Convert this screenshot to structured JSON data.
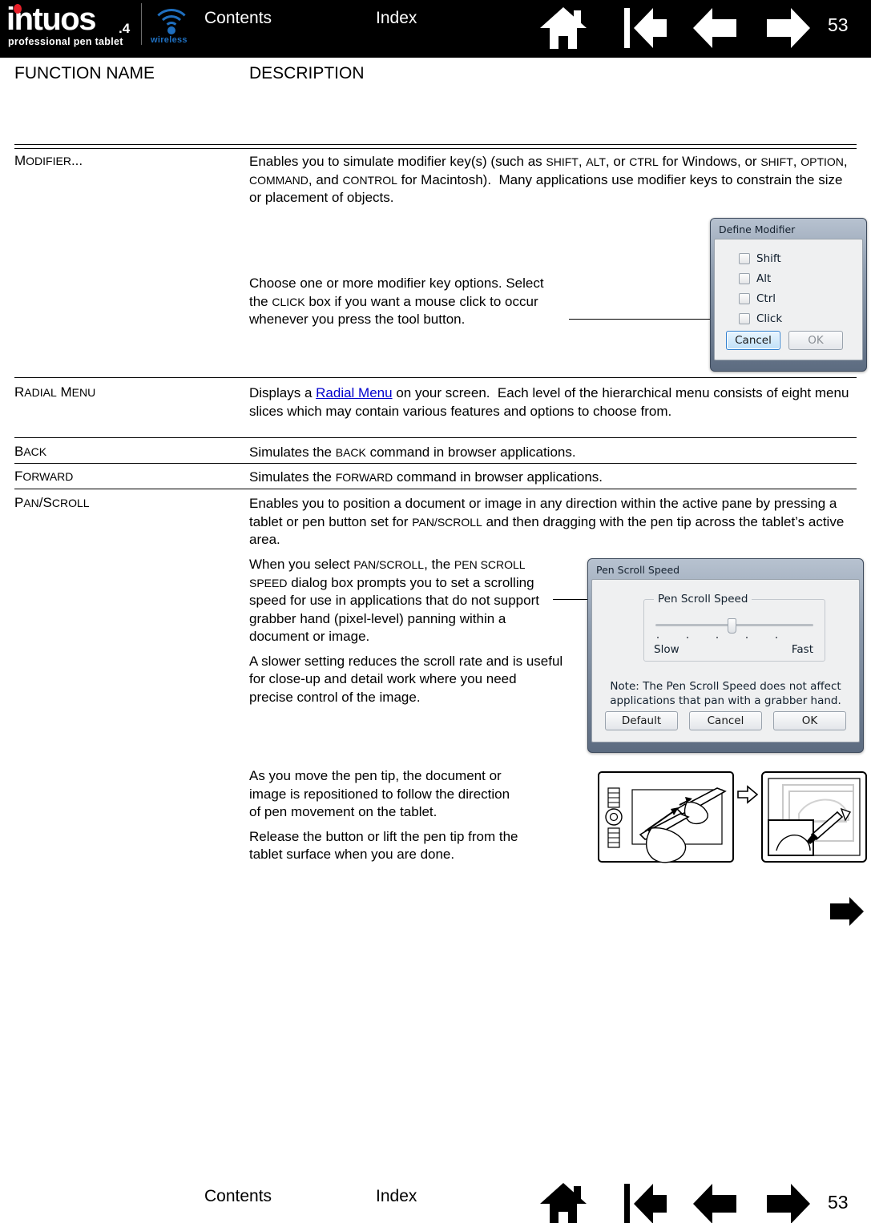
{
  "header": {
    "logo": {
      "brand": "intuos",
      "brand_suffix": ".4",
      "tagline": "professional pen tablet",
      "wireless_label": "wireless",
      "brand_dot_color": "#e8202a",
      "wireless_color": "#1f6fbf"
    },
    "contents_label": "Contents",
    "index_label": "Index",
    "page_number": "53",
    "background_color": "#000000",
    "icons": [
      {
        "name": "home-icon",
        "title": "Home"
      },
      {
        "name": "first-page-icon",
        "title": "First page"
      },
      {
        "name": "previous-page-icon",
        "title": "Previous page"
      },
      {
        "name": "next-page-icon",
        "title": "Next page"
      }
    ]
  },
  "table": {
    "columns": [
      "FUNCTION NAME",
      "DESCRIPTION"
    ],
    "rows": [
      {
        "name_plain": "MODIFIER...",
        "name_cap": "M",
        "name_rest": "ODIFIER...",
        "description_html": "Enables you to simulate modifier key(s) (such as <span class=\"sc\">SHIFT</span>, <span class=\"sc\">ALT</span>, or <span class=\"sc\">CTRL</span> for Windows, or <span class=\"sc\">SHIFT</span>, <span class=\"sc\">OPTION</span>, <span class=\"sc\">COMMAND</span>, and <span class=\"sc\">CONTROL</span> for Macintosh).&nbsp; Many applications use modifier keys to constrain the size or placement of objects."
      },
      {
        "name_plain": "RADIAL MENU",
        "description_html": "Displays a <a class=\"inline-link\" href=\"#\">Radial Menu</a> on your screen.&nbsp; Each level of the hierarchical menu consists of eight menu slices which may contain various features and options to choose from."
      },
      {
        "name_plain": "BACK",
        "description_html": "Simulates the <span class=\"sc\">BACK</span> command in browser applications."
      },
      {
        "name_plain": "FORWARD",
        "description_html": "Simulates the <span class=\"sc\">FORWARD</span> command in browser applications."
      },
      {
        "name_plain": "PAN/SCROLL",
        "description_html": "Enables you to position a document or image in any direction within the active pane by pressing a tablet or pen button set for <span class=\"sc\">PAN/SCROLL</span> and then dragging with the pen tip across the tablet’s active area."
      }
    ]
  },
  "modifier_note": "Choose one or more modifier key options. Select the <span class=\"sc\">CLICK</span> box if you want a mouse click to occur whenever you press the tool button.",
  "panscroll_notes": [
    "When you select <span class=\"sc\">PAN/SCROLL</span>, the <span class=\"sc\">PEN SCROLL SPEED</span> dialog box prompts you to set a scrolling speed for use in applications that do not support grabber hand (pixel-level) panning within a document or image.",
    "A slower setting reduces the scroll rate and is useful for close-up and detail work where you need precise control of the image."
  ],
  "panscroll_notes2": [
    "As you move the pen tip, the document or image is repositioned to follow the direction of pen movement on the tablet.",
    "Release the button or lift the pen tip from the tablet surface when you are done."
  ],
  "define_modifier_dialog": {
    "title": "Define Modifier",
    "checkboxes": [
      {
        "label": "Shift",
        "checked": false
      },
      {
        "label": "Alt",
        "checked": false
      },
      {
        "label": "Ctrl",
        "checked": false
      },
      {
        "label": "Click",
        "checked": false
      }
    ],
    "buttons": [
      {
        "label": "Cancel",
        "state": "focused"
      },
      {
        "label": "OK",
        "state": "disabled"
      }
    ]
  },
  "pen_scroll_speed_dialog": {
    "title": "Pen Scroll Speed",
    "group_title": "Pen Scroll Speed",
    "slider": {
      "min_label": "Slow",
      "max_label": "Fast",
      "ticks": 5,
      "value_percent": 48
    },
    "note": "Note: The Pen Scroll Speed does not affect applications that pan with a grabber hand.",
    "buttons": [
      {
        "label": "Default"
      },
      {
        "label": "Cancel"
      },
      {
        "label": "OK"
      }
    ]
  },
  "footer": {
    "contents_label": "Contents",
    "index_label": "Index",
    "page_number": "53",
    "icons": [
      {
        "name": "home-icon",
        "title": "Home"
      },
      {
        "name": "first-page-icon",
        "title": "First page"
      },
      {
        "name": "previous-page-icon",
        "title": "Previous page"
      },
      {
        "name": "next-page-icon",
        "title": "Next page"
      }
    ]
  }
}
